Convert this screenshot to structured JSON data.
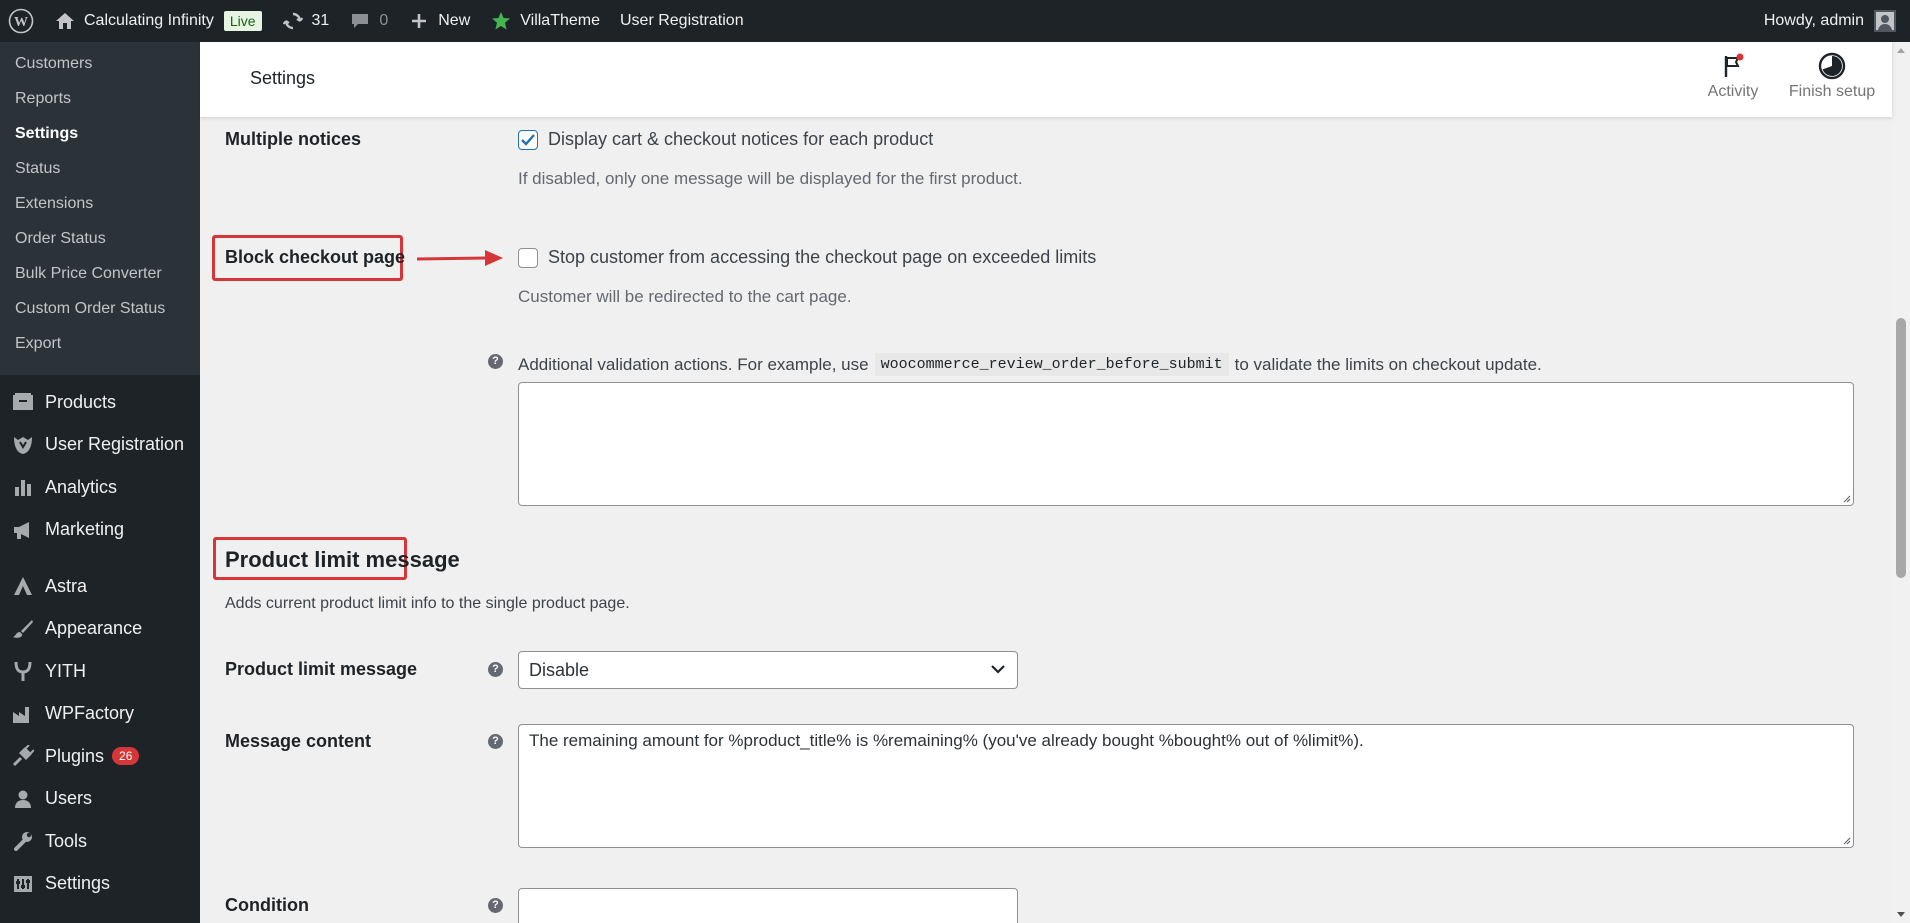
{
  "admin_bar": {
    "site_name": "Calculating Infinity",
    "live_badge": "Live",
    "updates_count": "31",
    "comments_count": "0",
    "new_label": "New",
    "villatheme_label": "VillaTheme",
    "user_registration_label": "User Registration",
    "greeting": "Howdy, admin"
  },
  "sidebar": {
    "submenu": [
      {
        "label": "Customers"
      },
      {
        "label": "Reports"
      },
      {
        "label": "Settings"
      },
      {
        "label": "Status"
      },
      {
        "label": "Extensions"
      },
      {
        "label": "Order Status"
      },
      {
        "label": "Bulk Price Converter"
      },
      {
        "label": "Custom Order Status"
      },
      {
        "label": "Export"
      }
    ],
    "menu": [
      {
        "label": "Products",
        "icon": "products-icon"
      },
      {
        "label": "User Registration",
        "icon": "user-registration-icon"
      },
      {
        "label": "Analytics",
        "icon": "analytics-icon"
      },
      {
        "label": "Marketing",
        "icon": "megaphone-icon"
      },
      {
        "label": "Astra",
        "icon": "astra-icon"
      },
      {
        "label": "Appearance",
        "icon": "paintbrush-icon"
      },
      {
        "label": "YITH",
        "icon": "yith-icon"
      },
      {
        "label": "WPFactory",
        "icon": "factory-icon"
      },
      {
        "label": "Plugins",
        "icon": "plugin-icon",
        "badge": "26"
      },
      {
        "label": "Users",
        "icon": "users-icon"
      },
      {
        "label": "Tools",
        "icon": "wrench-icon"
      },
      {
        "label": "Settings",
        "icon": "settings-icon"
      }
    ]
  },
  "header": {
    "title": "Settings",
    "activity_label": "Activity",
    "finish_setup_label": "Finish setup"
  },
  "form": {
    "multiple_notices": {
      "label": "Multiple notices",
      "checkbox_label": "Display cart & checkout notices for each product",
      "checked": true,
      "description": "If disabled, only one message will be displayed for the first product."
    },
    "block_checkout": {
      "label": "Block checkout page",
      "checkbox_label": "Stop customer from accessing the checkout page on exceeded limits",
      "checked": false,
      "description": "Customer will be redirected to the cart page."
    },
    "validation_actions": {
      "text_before": "Additional validation actions. For example, use",
      "code": "woocommerce_review_order_before_submit",
      "text_after": "to validate the limits on checkout update.",
      "value": ""
    },
    "product_limit_section": {
      "title": "Product limit message",
      "description": "Adds current product limit info to the single product page."
    },
    "product_limit_message": {
      "label": "Product limit message",
      "selected": "Disable"
    },
    "message_content": {
      "label": "Message content",
      "value": "The remaining amount for %product_title% is %remaining% (you've already bought %bought% out of %limit%)."
    },
    "condition": {
      "label": "Condition",
      "value": ""
    }
  },
  "colors": {
    "admin_bar_bg": "#1d2327",
    "accent": "#2271b1",
    "highlight": "#d63638"
  }
}
